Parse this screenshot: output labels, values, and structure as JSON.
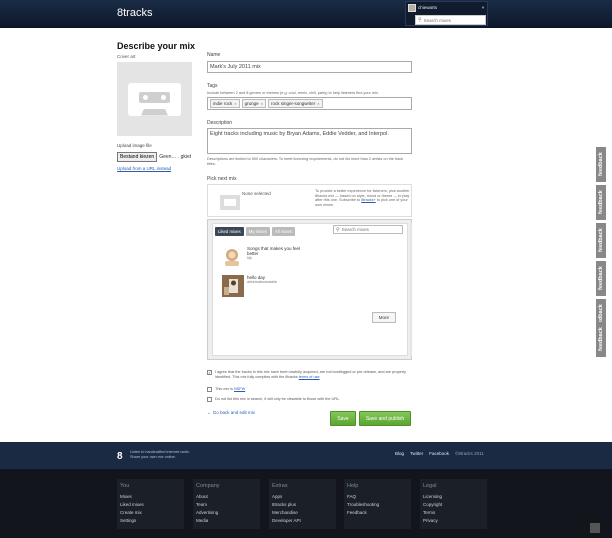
{
  "header": {
    "logo": "8tracks",
    "user_name": "chiewarts",
    "search_placeholder": "Search mixes"
  },
  "page": {
    "title": "Describe your mix",
    "cover_label": "Cover art",
    "upload_label": "Upload image file",
    "browse_label": "Bestand kiezen",
    "file_status": "Geen… . gkiet",
    "upload_url": "Upload from a URL instead"
  },
  "form": {
    "name_label": "Name",
    "name_value": "Mark's July 2011 mix",
    "tags_label": "Tags",
    "tags_hint": "Include between 2 and 8 genres or themes (e.g. cool, remix, chill, party) to help listeners find your mix.",
    "tags": [
      "indie rock",
      "grunge",
      "rock singer-songwriter"
    ],
    "description_label": "Description",
    "description_value": "Eight tracks including music by Bryan Adams, Eddie Vedder, and Interpol.",
    "description_hint": "Descriptions are limited to 500 characters. To meet licensing requirements, do not list more than 2 artists on the track titles.",
    "next_label": "Pick next mix",
    "none_selected": "None selected",
    "next_text": "To provide a better experience for listeners, pick another 8tracks mix — based on style, mood or theme — to play after this one. Subscribe to",
    "next_link": "8tracks+",
    "next_tail": "to pick one of your own mixes.",
    "tabs": [
      "Liked mixes",
      "My mixes",
      "All mixes"
    ],
    "mini_search_placeholder": "Search mixes",
    "mixes": [
      {
        "title": "Songs that makes you feel better",
        "by": "hjk"
      },
      {
        "title": "hello day",
        "by": "alicemalecesiable"
      }
    ],
    "more_label": "More",
    "agree_text": "I agree that the tracks in this mix have been lawfully acquired, are not bootlegged or pre-release, and are properly identified. This mix fully complies with the 8tracks",
    "agree_link": "terms of use",
    "nsfw_text": "This mix is",
    "nsfw_link": "NSFW",
    "hide_text": "Do not list this mix in search, it will only be viewable to those with the URL.",
    "back_link": "← Go back and edit mix",
    "save_label": "Save",
    "publish_label": "Save and publish"
  },
  "feedback_label": "feedback",
  "footer": {
    "logo": "8",
    "tagline_1": "Listen to handcrafted internet radio.",
    "tagline_2": "Share your own mix online.",
    "links": [
      "Blog",
      "Twitter",
      "Facebook"
    ],
    "copyright": "©8tracks 2011",
    "columns": [
      {
        "heading": "You",
        "items": [
          "Mixes",
          "Liked mixes",
          "Create mix",
          "Settings"
        ]
      },
      {
        "heading": "Company",
        "items": [
          "About",
          "Team",
          "Advertising",
          "Media"
        ]
      },
      {
        "heading": "Extras",
        "items": [
          "Apps",
          "8tracks plus",
          "Merchandise",
          "Developer API"
        ]
      },
      {
        "heading": "Help",
        "items": [
          "FAQ",
          "Troubleshooting",
          "Feedback"
        ]
      },
      {
        "heading": "Legal",
        "items": [
          "Licensing",
          "Copyright",
          "Terms",
          "Privacy"
        ]
      }
    ]
  },
  "colors": {
    "header_bg": "#1b2c47",
    "accent_green": "#66b33a",
    "link_blue": "#2a5db0",
    "footer_bg": "#12161c"
  }
}
